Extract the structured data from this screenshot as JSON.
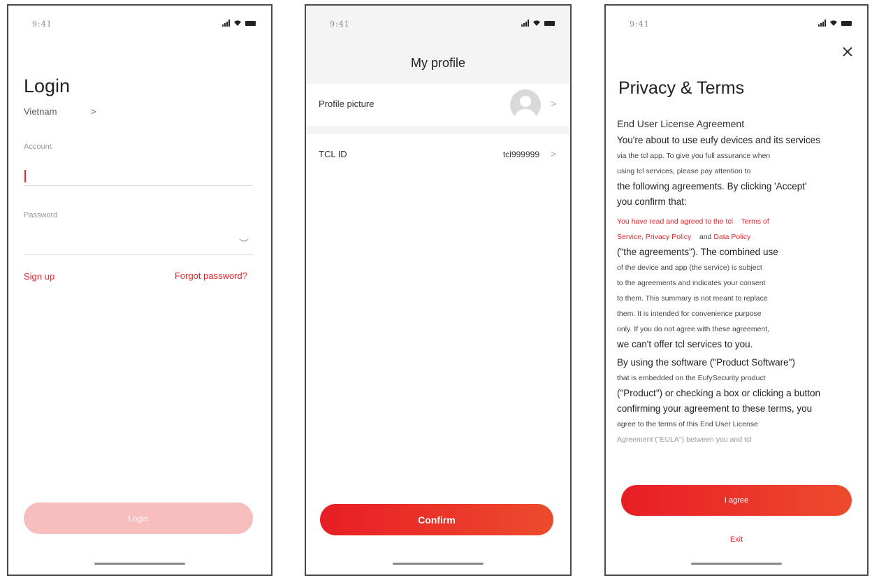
{
  "status_bar": {
    "time": "9:41"
  },
  "login_screen": {
    "title": "Login",
    "region": "Vietnam",
    "region_chevron": ">",
    "account_label": "Account",
    "password_label": "Password",
    "sign_up": "Sign up",
    "forgot_password": "Forgot password?",
    "login_button": "Login"
  },
  "profile_screen": {
    "title": "My profile",
    "profile_picture_label": "Profile picture",
    "tcl_id_label": "TCL ID",
    "tcl_id_value": "tcl999999",
    "chevron": ">",
    "confirm_button": "Confirm"
  },
  "privacy_screen": {
    "title": "Privacy & Terms",
    "close": "×",
    "section_heading": "End User License Agreement",
    "p1_line1": "You're about to use eufy devices and its services",
    "p1_line2": "via the tcl app. To give you full assurance when",
    "p1_line3": "using tcl services, please pay attention to",
    "p1_line4": "the following agreements. By clicking 'Accept'",
    "p1_line5": "you confirm that:",
    "p2_prefix": "You have read and agreed to the tcl",
    "p2_link_terms_1": "Terms of",
    "p2_link_terms_2": "Service, Privacy Policy",
    "p2_and": "and",
    "p2_link_data": "Data Policy",
    "p2_line2": "(\"the agreements\"). The combined use",
    "p2_line3": "of the device and app (the service) is subject",
    "p2_line4": "to the agreements and indicates your consent",
    "p2_line5": "to them. This summary is not meant to replace",
    "p2_line6": "them. It is intended for convenience purpose",
    "p2_line7": "only. If you do not agree with these agreement,",
    "p2_line8": "we can't offer tcl services to you.",
    "p3_line1": "By using the software (\"Product Software\")",
    "p3_line2": "that is embedded on the EufySecurity product",
    "p3_line3": "(\"Product\") or checking a box or clicking a button",
    "p3_line4": "confirming your agreement to these terms, you",
    "p3_line5": "agree to the terms of this End User License",
    "p3_line6": "Agreement (\"EULA\") between you and tcl",
    "agree_button": "I agree",
    "exit": "Exit"
  }
}
